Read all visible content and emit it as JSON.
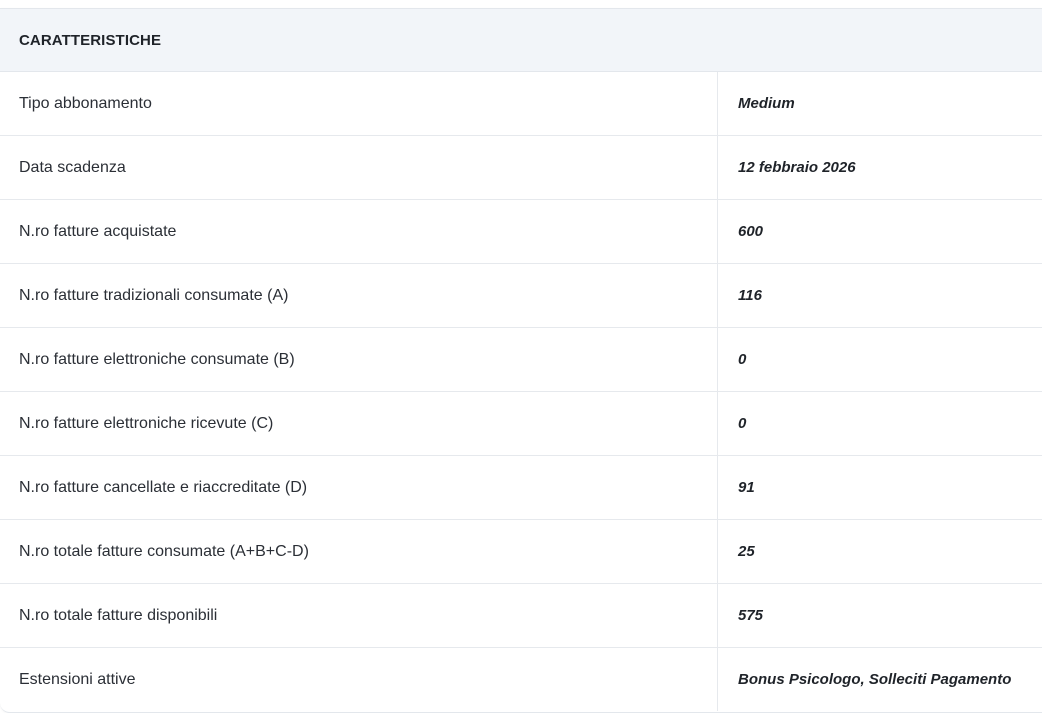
{
  "section": {
    "title": "CARATTERISTICHE"
  },
  "rows": [
    {
      "label": "Tipo abbonamento",
      "value": "Medium"
    },
    {
      "label": "Data scadenza",
      "value": "12 febbraio 2026"
    },
    {
      "label": "N.ro fatture acquistate",
      "value": "600"
    },
    {
      "label": "N.ro fatture tradizionali consumate (A)",
      "value": "116"
    },
    {
      "label": "N.ro fatture elettroniche consumate (B)",
      "value": "0"
    },
    {
      "label": "N.ro fatture elettroniche ricevute (C)",
      "value": "0"
    },
    {
      "label": "N.ro fatture cancellate e riaccreditate (D)",
      "value": "91"
    },
    {
      "label": "N.ro totale fatture consumate (A+B+C-D)",
      "value": "25"
    },
    {
      "label": "N.ro totale fatture disponibili",
      "value": "575"
    },
    {
      "label": "Estensioni attive",
      "value": "Bonus Psicologo, Solleciti Pagamento"
    }
  ]
}
